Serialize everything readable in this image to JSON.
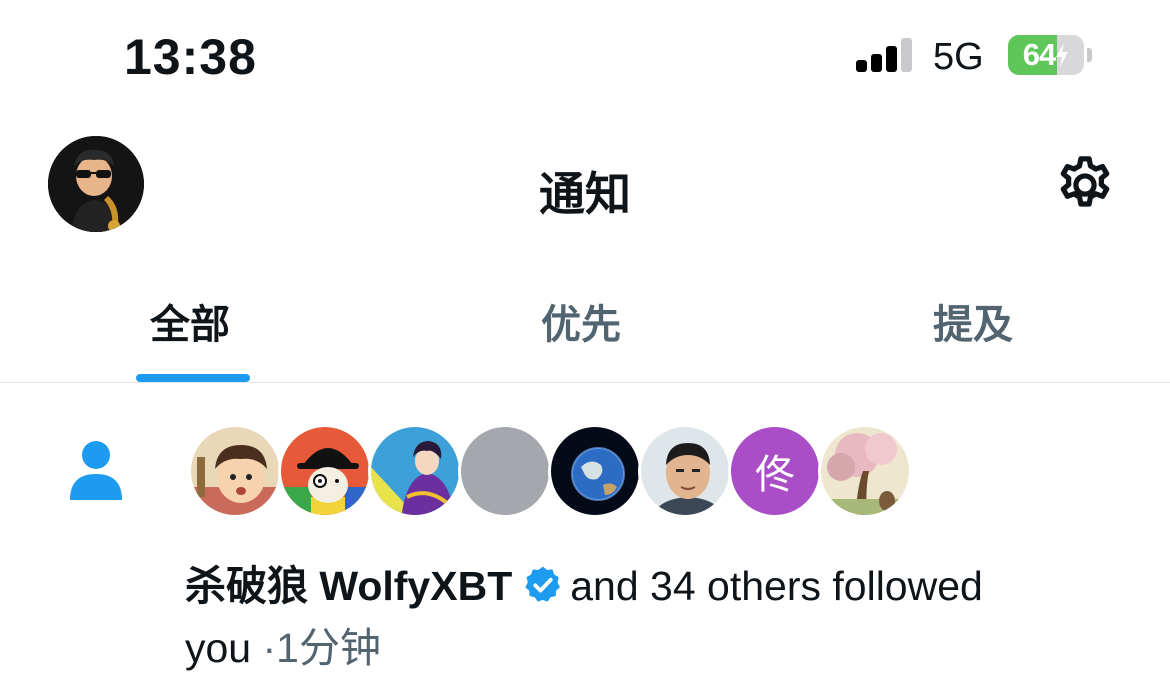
{
  "status_bar": {
    "time": "13:38",
    "network": "5G",
    "battery_level": "64",
    "battery_fraction": 0.64,
    "battery_charging": true
  },
  "header": {
    "title": "通知"
  },
  "tabs": [
    {
      "label": "全部",
      "active": true
    },
    {
      "label": "优先",
      "active": false
    },
    {
      "label": "提及",
      "active": false
    }
  ],
  "notification": {
    "type": "follow",
    "avatars": [
      {
        "kind": "image",
        "desc": "anime-boy"
      },
      {
        "kind": "image",
        "desc": "clockwork-orange"
      },
      {
        "kind": "image",
        "desc": "anime-girl-purple"
      },
      {
        "kind": "blank"
      },
      {
        "kind": "image",
        "desc": "earth"
      },
      {
        "kind": "image",
        "desc": "man-portrait"
      },
      {
        "kind": "letter",
        "letter": "佟"
      },
      {
        "kind": "image",
        "desc": "tree-painting"
      }
    ],
    "user_name": "杀破狼 WolfyXBT",
    "verified": true,
    "text_rest": "and 34 others followed",
    "text_wrap": "you",
    "separator": "·",
    "time_ago": "1分钟"
  },
  "colors": {
    "accent": "#1d9bf0",
    "battery": "#5fc75a",
    "letter_avatar": "#a94ec7",
    "secondary_text": "#536471"
  }
}
